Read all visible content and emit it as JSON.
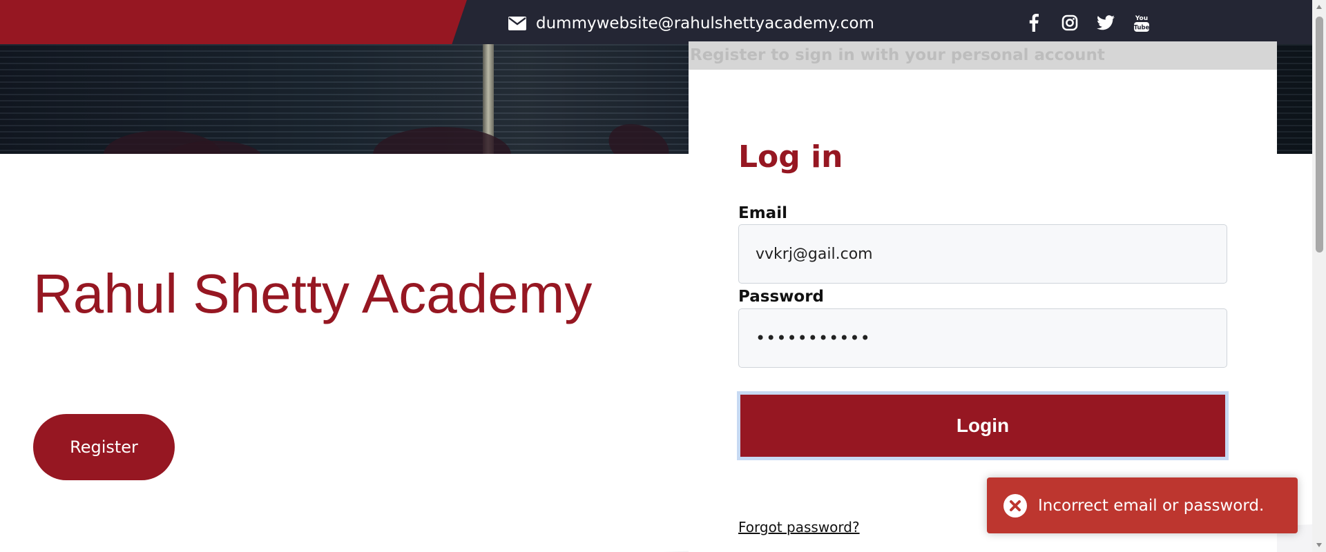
{
  "header": {
    "email": "dummywebsite@rahulshettyacademy.com",
    "social_icons": [
      "facebook-icon",
      "instagram-icon",
      "twitter-icon",
      "youtube-icon"
    ],
    "youtube_text": "You Tube"
  },
  "brand": {
    "title": "Rahul Shetty Academy"
  },
  "register_button": "Register",
  "login": {
    "banner_text": "Register to sign in with your personal account",
    "title": "Log in",
    "email_label": "Email",
    "email_value": "vvkrj@gail.com",
    "password_label": "Password",
    "password_value": "•••••••••••",
    "login_button": "Login",
    "forgot_password": "Forgot password?"
  },
  "toast": {
    "message": "Incorrect email or password."
  },
  "colors": {
    "brand": "#961722",
    "topbar": "#242634",
    "toast": "#bd362f"
  }
}
